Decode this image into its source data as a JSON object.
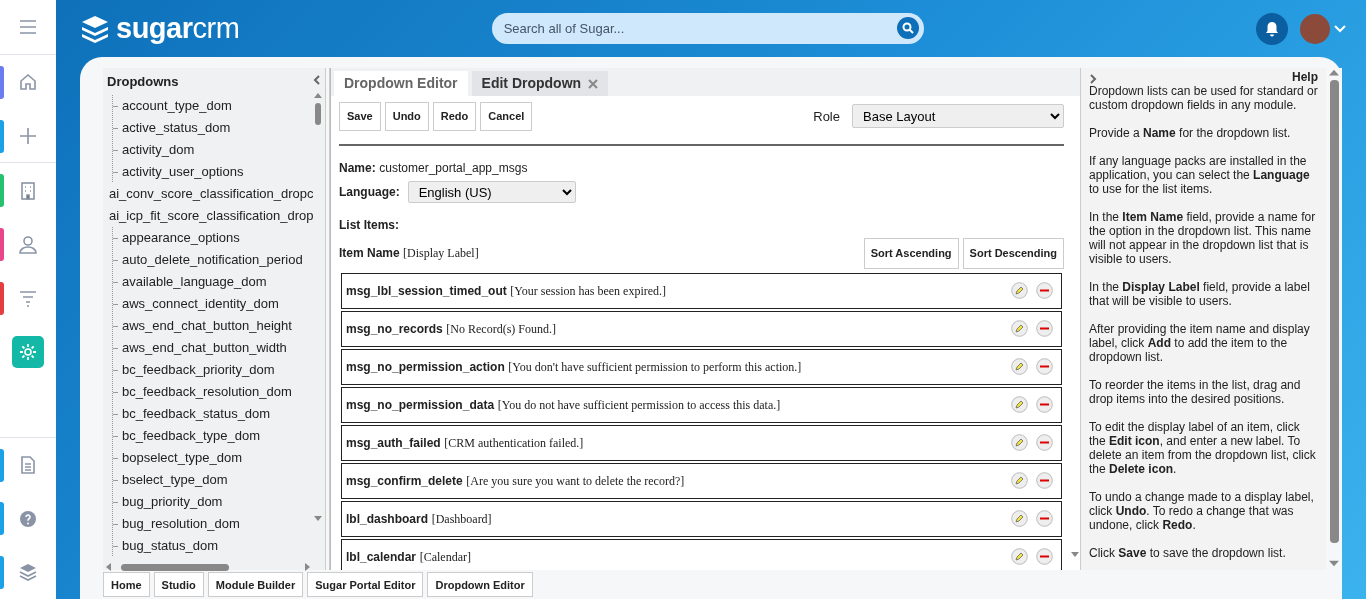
{
  "rail": [
    {
      "selected": false
    },
    {
      "color": "#6b7cf0",
      "selected": false
    },
    {
      "color": "#1aa1e6",
      "selected": false
    },
    {
      "color": "#25c16f",
      "selected": false
    },
    {
      "color": "#e8458b",
      "selected": false
    },
    {
      "color": "#e53e3e",
      "selected": false
    },
    {
      "selected": true
    },
    {
      "color": "#1aa1e6",
      "selected": false
    },
    {
      "color": "#1aa1e6",
      "selected": false
    },
    {
      "color": "#1aa1e6",
      "selected": false
    }
  ],
  "header": {
    "logo": "sugarcrm",
    "search": {
      "placeholder": "Search all of Sugar..."
    }
  },
  "dropdowns": {
    "title": "Dropdowns",
    "items": [
      {
        "label": "account_type_dom",
        "kind": "indented"
      },
      {
        "label": "active_status_dom",
        "kind": "indented"
      },
      {
        "label": "activity_dom",
        "kind": "indented"
      },
      {
        "label": "activity_user_options",
        "kind": "indented"
      },
      {
        "label": "ai_conv_score_classification_dropc",
        "kind": "plain"
      },
      {
        "label": "ai_icp_fit_score_classification_drop",
        "kind": "plain"
      },
      {
        "label": "appearance_options",
        "kind": "indented"
      },
      {
        "label": "auto_delete_notification_period",
        "kind": "indented"
      },
      {
        "label": "available_language_dom",
        "kind": "indented"
      },
      {
        "label": "aws_connect_identity_dom",
        "kind": "indented"
      },
      {
        "label": "aws_end_chat_button_height",
        "kind": "indented"
      },
      {
        "label": "aws_end_chat_button_width",
        "kind": "indented"
      },
      {
        "label": "bc_feedback_priority_dom",
        "kind": "indented"
      },
      {
        "label": "bc_feedback_resolution_dom",
        "kind": "indented"
      },
      {
        "label": "bc_feedback_status_dom",
        "kind": "indented"
      },
      {
        "label": "bc_feedback_type_dom",
        "kind": "indented"
      },
      {
        "label": "bopselect_type_dom",
        "kind": "indented"
      },
      {
        "label": "bselect_type_dom",
        "kind": "indented"
      },
      {
        "label": "bug_priority_dom",
        "kind": "indented"
      },
      {
        "label": "bug_resolution_dom",
        "kind": "indented"
      },
      {
        "label": "bug_status_dom",
        "kind": "indented"
      }
    ]
  },
  "tabs": [
    {
      "label": "Dropdown Editor",
      "selected": true,
      "closable": false
    },
    {
      "label": "Edit Dropdown",
      "selected": false,
      "closable": true
    }
  ],
  "toolbar": [
    "Save",
    "Undo",
    "Redo",
    "Cancel"
  ],
  "role": {
    "label": "Role",
    "value": "Base Layout"
  },
  "name": {
    "label": "Name:",
    "value": "customer_portal_app_msgs"
  },
  "language": {
    "label": "Language:",
    "value": "English (US)"
  },
  "list_items_label": "List Items:",
  "column_header": {
    "name": "Item Name",
    "label": "[Display Label]"
  },
  "sort_buttons": [
    "Sort Ascending",
    "Sort Descending"
  ],
  "items": [
    {
      "name": "msg_lbl_session_timed_out",
      "label": "[Your session has been expired.]"
    },
    {
      "name": "msg_no_records",
      "label": "[No Record(s) Found.]"
    },
    {
      "name": "msg_no_permission_action",
      "label": "[You don't have sufficient permission to perform this action.]"
    },
    {
      "name": "msg_no_permission_data",
      "label": "[You do not have sufficient permission to access this data.]"
    },
    {
      "name": "msg_auth_failed",
      "label": "[CRM authentication failed.]"
    },
    {
      "name": "msg_confirm_delete",
      "label": "[Are you sure you want to delete the record?]"
    },
    {
      "name": "lbl_dashboard",
      "label": "[Dashboard]"
    },
    {
      "name": "lbl_calendar",
      "label": "[Calendar]"
    }
  ],
  "help": {
    "title": "Help",
    "paragraphs": [
      "Dropdown lists can be used for standard or custom dropdown fields in any module.",
      "Provide a **Name** for the dropdown list.",
      "If any language packs are installed in the application, you can select the **Language** to use for the list items.",
      "In the **Item Name** field, provide a name for the option in the dropdown list. This name will not appear in the dropdown list that is visible to users.",
      "In the **Display Label** field, provide a label that will be visible to users.",
      "After providing the item name and display label, click **Add** to add the item to the dropdown list.",
      "To reorder the items in the list, drag and drop items into the desired positions.",
      "To edit the display label of an item, click the **Edit icon**, and enter a new label. To delete an item from the dropdown list, click the **Delete icon**.",
      "To undo a change made to a display label, click **Undo**. To redo a change that was undone, click **Redo**.",
      "Click **Save** to save the dropdown list."
    ]
  },
  "footer_tabs": [
    "Home",
    "Studio",
    "Module Builder",
    "Sugar Portal Editor",
    "Dropdown Editor"
  ]
}
